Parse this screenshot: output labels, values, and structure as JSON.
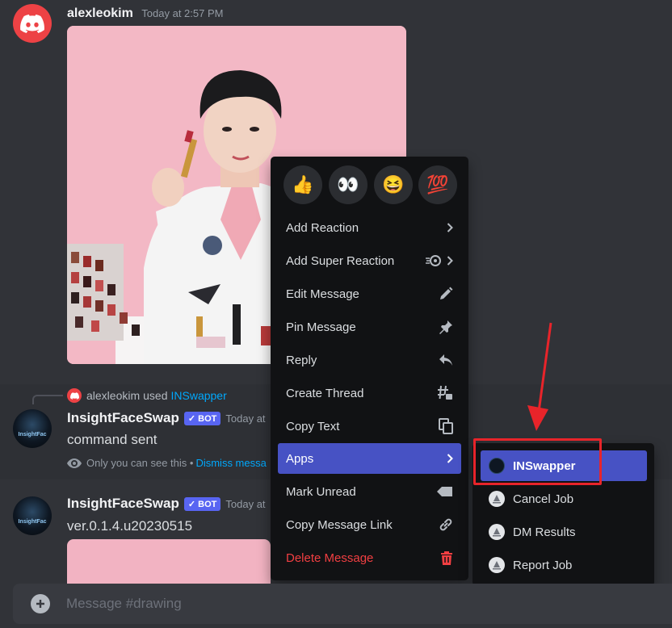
{
  "messages": [
    {
      "author": "alexleokim",
      "timestamp": "Today at 2:57 PM"
    },
    {
      "reply": {
        "user": "alexleokim",
        "action": "used",
        "command": "INSwapper"
      },
      "author": "InsightFaceSwap",
      "bot_tag": "BOT",
      "timestamp": "Today at",
      "text": "command sent",
      "ephemeral_note": "Only you can see this •",
      "dismiss_label": "Dismiss messa"
    },
    {
      "author": "InsightFaceSwap",
      "bot_tag": "BOT",
      "timestamp": "Today at",
      "text": "ver.0.1.4.u20230515"
    }
  ],
  "bot_avatar_text": "InsightFac",
  "context_menu": {
    "quick_reactions": [
      "👍",
      "👀",
      "😆",
      "💯"
    ],
    "items": [
      {
        "label": "Add Reaction",
        "icon": "chevron-right-icon"
      },
      {
        "label": "Add Super Reaction",
        "icon": "super-reaction-icon"
      },
      {
        "label": "Edit Message",
        "icon": "pencil-icon"
      },
      {
        "label": "Pin Message",
        "icon": "pin-icon"
      },
      {
        "label": "Reply",
        "icon": "reply-icon"
      },
      {
        "label": "Create Thread",
        "icon": "thread-icon"
      },
      {
        "label": "Copy Text",
        "icon": "copy-icon"
      },
      {
        "label": "Apps",
        "icon": "chevron-right-icon"
      },
      {
        "label": "Mark Unread",
        "icon": "mark-unread-icon"
      },
      {
        "label": "Copy Message Link",
        "icon": "link-icon"
      },
      {
        "label": "Delete Message",
        "icon": "trash-icon"
      }
    ]
  },
  "apps_submenu": {
    "items": [
      {
        "label": "INSwapper"
      },
      {
        "label": "Cancel Job"
      },
      {
        "label": "DM Results"
      },
      {
        "label": "Report Job"
      }
    ]
  },
  "composer": {
    "placeholder": "Message #drawing"
  },
  "colors": {
    "background": "#313338",
    "menu": "#111214",
    "accent": "#4752c4",
    "danger": "#f23f42",
    "annotation": "#e8242a"
  }
}
